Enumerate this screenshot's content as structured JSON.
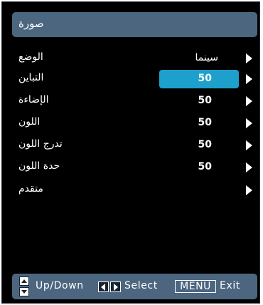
{
  "menu": {
    "title": "صورة",
    "rows": [
      {
        "label": "الوضع",
        "value": "سينما"
      },
      {
        "label": "التباين",
        "value": "50"
      },
      {
        "label": "الإضاءة",
        "value": "50"
      },
      {
        "label": "اللون",
        "value": "50"
      },
      {
        "label": "تدرج اللون",
        "value": "50"
      },
      {
        "label": "حدة اللون",
        "value": "50"
      },
      {
        "label": "متقدم",
        "value": ""
      }
    ],
    "selected_index": 1
  },
  "footer": {
    "updown_label": "Up/Down",
    "select_label": "Select",
    "menu_key": "MENU",
    "exit_label": "Exit"
  },
  "colors": {
    "panel": "#000000",
    "bar": "#4c6680",
    "highlight": "#1ea0cd"
  },
  "icons": [
    "arrow-right-icon",
    "up-down-keys-icon",
    "left-right-keys-icon"
  ]
}
